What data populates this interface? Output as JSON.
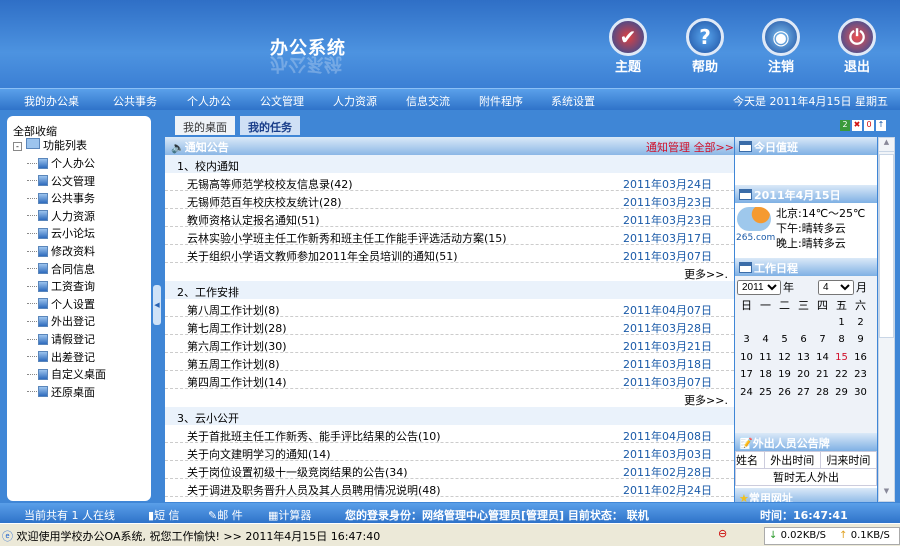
{
  "header": {
    "title": "办公系统",
    "buttons": [
      {
        "label": "主题",
        "icon": "theme-icon"
      },
      {
        "label": "帮助",
        "icon": "help-icon"
      },
      {
        "label": "注销",
        "icon": "logout-icon"
      },
      {
        "label": "退出",
        "icon": "exit-icon"
      }
    ]
  },
  "nav": {
    "items": [
      "我的办公桌",
      "公共事务",
      "个人办公",
      "公文管理",
      "人力资源",
      "信息交流",
      "附件程序",
      "系统设置"
    ],
    "today": "今天是 2011年4月15日 星期五"
  },
  "sidebar": {
    "collapse_all": "全部收缩",
    "root": "功能列表",
    "items": [
      "个人办公",
      "公文管理",
      "公共事务",
      "人力资源",
      "云小论坛",
      "修改资料",
      "合同信息",
      "工资查询",
      "个人设置",
      "外出登记",
      "请假登记",
      "出差登记",
      "自定义桌面",
      "还原桌面"
    ]
  },
  "tabs": [
    "我的桌面",
    "我的任务"
  ],
  "notices": {
    "title": "通知公告",
    "manage": "通知管理",
    "all": "全部>>",
    "more": "更多>>.",
    "sections": [
      {
        "title": "1、校内通知",
        "rows": [
          {
            "t": "无锡高等师范学校校友信息录(42)",
            "d": "2011年03月24日"
          },
          {
            "t": "无锡师范百年校庆校友统计(28)",
            "d": "2011年03月23日"
          },
          {
            "t": "教师资格认定报名通知(51)",
            "d": "2011年03月23日"
          },
          {
            "t": "云林实验小学班主任工作新秀和班主任工作能手评选活动方案(15)",
            "d": "2011年03月17日"
          },
          {
            "t": "关于组织小学语文教师参加2011年全员培训的通知(51)",
            "d": "2011年03月07日"
          }
        ]
      },
      {
        "title": "2、工作安排",
        "rows": [
          {
            "t": "第八周工作计划(8)",
            "d": "2011年04月07日"
          },
          {
            "t": "第七周工作计划(28)",
            "d": "2011年03月28日"
          },
          {
            "t": "第六周工作计划(30)",
            "d": "2011年03月21日"
          },
          {
            "t": "第五周工作计划(8)",
            "d": "2011年03月18日"
          },
          {
            "t": "第四周工作计划(14)",
            "d": "2011年03月07日"
          }
        ]
      },
      {
        "title": "3、云小公开",
        "rows": [
          {
            "t": "关于首批班主任工作新秀、能手评比结果的公告(10)",
            "d": "2011年04月08日"
          },
          {
            "t": "关于向文建明学习的通知(14)",
            "d": "2011年03月03日"
          },
          {
            "t": "关于岗位设置初级十一级竞岗结果的公告(34)",
            "d": "2011年02月28日"
          },
          {
            "t": "关于调进及职务晋升人员及其人员聘用情况说明(48)",
            "d": "2011年02月24日"
          }
        ]
      }
    ]
  },
  "right": {
    "duty_title": "今日值班",
    "date_title": "2011年4月15日",
    "weather": {
      "brand": "265.com",
      "line1": "北京:14℃～25℃",
      "line2": "下午:晴转多云",
      "line3": "晚上:晴转多云"
    },
    "schedule_title": "工作日程",
    "year": "2011",
    "year_unit": "年",
    "month": "4",
    "month_unit": "月",
    "weekdays": [
      "日",
      "一",
      "二",
      "三",
      "四",
      "五",
      "六"
    ],
    "today": 15,
    "out_title": "外出人员公告牌",
    "out_cols": [
      "姓名",
      "外出时间",
      "归来时间"
    ],
    "out_empty": "暂时无人外出",
    "links_title": "常用网址"
  },
  "status": {
    "online": "当前共有 1 人在线",
    "sms": "短 信",
    "mail": "邮 件",
    "calc": "计算器",
    "identity": "您的登录身份：网络管理中心管理员[管理员]  目前状态： 联机",
    "time": "时间：16:47:41"
  },
  "taskbar": {
    "message": "欢迎使用学校办公OA系统, 祝您工作愉快! >> 2011年4月15日 16:47:40",
    "down": "0.02KB/S",
    "up": "0.1KB/S"
  },
  "colors": {
    "accent": "#3f86d6",
    "date": "#1a5aa8",
    "red": "#d0102a"
  }
}
